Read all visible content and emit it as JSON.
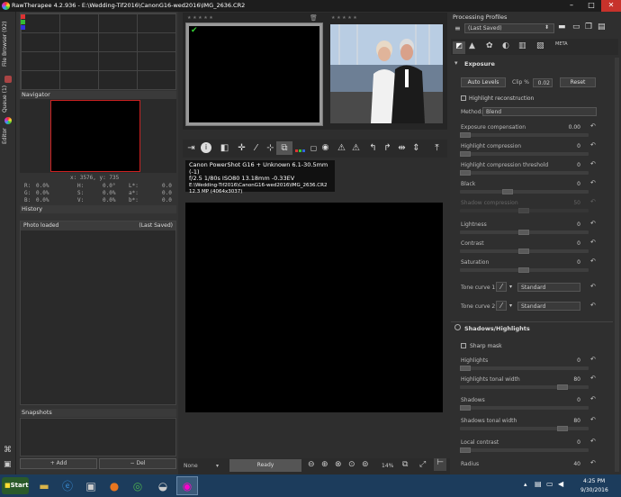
{
  "window": {
    "title": "RawTherapee 4.2.936 - E:\\Wedding-Tif2016\\CanonG16-wed2016\\IMG_2636.CR2",
    "min": "–",
    "max": "□",
    "close": "✕"
  },
  "sidetabs": {
    "file_browser": "File Browser (92)",
    "queue": "Queue (1)",
    "editor": "Editor"
  },
  "navigator": {
    "title": "Navigator",
    "coords": "x: 3576, y: 735",
    "readout": [
      {
        "a": "R:",
        "av": "0.0%",
        "b": "H:",
        "bv": "0.0°",
        "c": "L*:",
        "cv": "0.0"
      },
      {
        "a": "G:",
        "av": "0.0%",
        "b": "S:",
        "bv": "0.0%",
        "c": "a*:",
        "cv": "0.0"
      },
      {
        "a": "B:",
        "av": "0.0%",
        "b": "V:",
        "bv": "0.0%",
        "c": "b*:",
        "cv": "0.0"
      }
    ]
  },
  "history": {
    "title": "History",
    "row_label": "Photo loaded",
    "row_value": "(Last Saved)"
  },
  "snapshots": {
    "title": "Snapshots",
    "add": "+ Add",
    "del": "− Del"
  },
  "filmstrip": {
    "stars": "★ ★ ★ ★ ★",
    "checkmark": "✔"
  },
  "info": {
    "line1": "Canon PowerShot G16 + Unknown 6.1-30.5mm (-1)",
    "line2": "f/2.5  1/80s  ISO80  13.18mm  -0.33EV",
    "line3": "E:\\Wedding-Tif2016\\CanonG16-wed2016\\IMG_2636.CR2",
    "line4": "12.3 MP (4064x3037)"
  },
  "status": {
    "left": "None",
    "ready": "Ready",
    "zoom": "14%"
  },
  "profiles": {
    "title": "Processing Profiles",
    "value": "(Last Saved)"
  },
  "exposure": {
    "title": "Exposure",
    "auto_levels": "Auto Levels",
    "clip_label": "Clip %",
    "clip_value": "0.02",
    "reset": "Reset",
    "highlight_recon": "Highlight reconstruction",
    "method_label": "Method:",
    "method_value": "Blend",
    "rows": [
      {
        "label": "Exposure compensation",
        "value": "0.00"
      },
      {
        "label": "Highlight compression",
        "value": "0"
      },
      {
        "label": "Highlight compression threshold",
        "value": "0"
      },
      {
        "label": "Black",
        "value": "0"
      },
      {
        "label": "Shadow compression",
        "value": "50"
      },
      {
        "label": "Lightness",
        "value": "0"
      },
      {
        "label": "Contrast",
        "value": "0"
      },
      {
        "label": "Saturation",
        "value": "0"
      }
    ],
    "tone1_label": "Tone curve 1:",
    "tone1_value": "Standard",
    "tone2_label": "Tone curve 2:",
    "tone2_value": "Standard"
  },
  "shadows": {
    "title": "Shadows/Highlights",
    "sharp_mask": "Sharp mask",
    "rows": [
      {
        "label": "Highlights",
        "value": "0"
      },
      {
        "label": "Highlights tonal width",
        "value": "80"
      },
      {
        "label": "Shadows",
        "value": "0"
      },
      {
        "label": "Shadows tonal width",
        "value": "80"
      },
      {
        "label": "Local contrast",
        "value": "0"
      },
      {
        "label": "Radius",
        "value": "40"
      }
    ]
  },
  "taskbar": {
    "start": "Start",
    "time": "4:25 PM",
    "date": "9/30/2016"
  }
}
